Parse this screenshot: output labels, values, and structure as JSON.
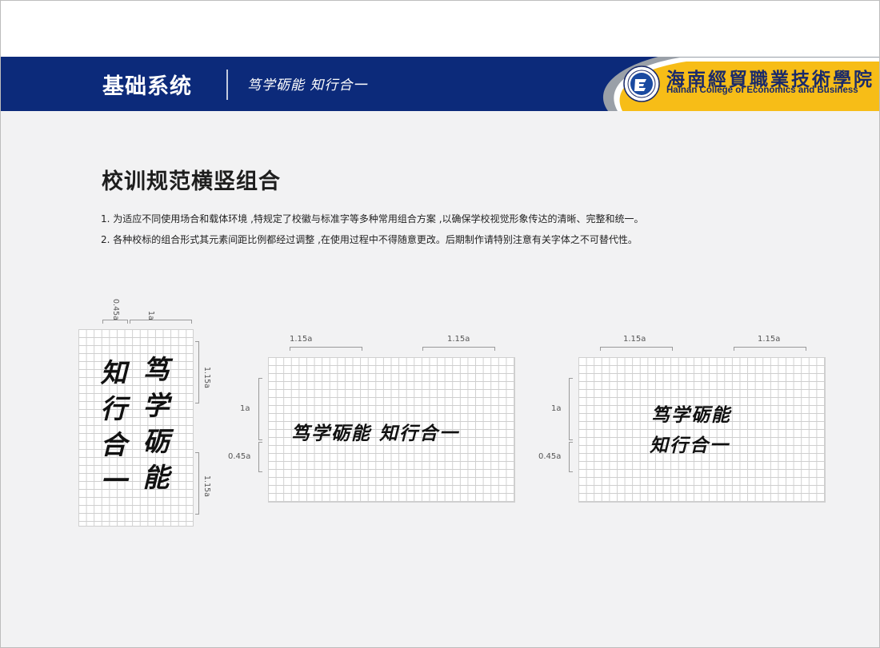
{
  "header": {
    "section_title": "基础系统",
    "slogan": "笃学砺能 知行合一",
    "college_name_cn": "海南經貿職業技術學院",
    "college_name_en": "Hainan College of Economics and Business",
    "colors": {
      "navy": "#0c2a7a",
      "yellow": "#f7bd17",
      "swoosh": "#9aa0a8"
    }
  },
  "page_title": "校训规范横竖组合",
  "notes": [
    "1. 为适应不同使用场合和载体环境 ,特规定了校徽与标准字等多种常用组合方案 ,以确保学校视觉形象传达的清晰、完整和统一。",
    "2. 各种校标的组合形式其元素间距比例都经过调整 ,在使用过程中不得随意更改。后期制作请特别注意有关字体之不可替代性。"
  ],
  "vertical_combo": {
    "label_col_gap": "0.45a",
    "label_col_width": "1a",
    "label_top": "1.15a",
    "label_bottom": "1.15a",
    "col_left": [
      "知",
      "行",
      "合",
      "一"
    ],
    "col_right": [
      "笃",
      "学",
      "砺",
      "能"
    ]
  },
  "horizontal_single": {
    "label_left": "1.15a",
    "label_right": "1.15a",
    "label_height": "1a",
    "label_bottom": "0.45a",
    "text": "笃学砺能 知行合一"
  },
  "horizontal_double": {
    "label_left": "1.15a",
    "label_right": "1.15a",
    "label_height": "1a",
    "label_bottom": "0.45a",
    "line1": "笃学砺能",
    "line2": "知行合一"
  }
}
